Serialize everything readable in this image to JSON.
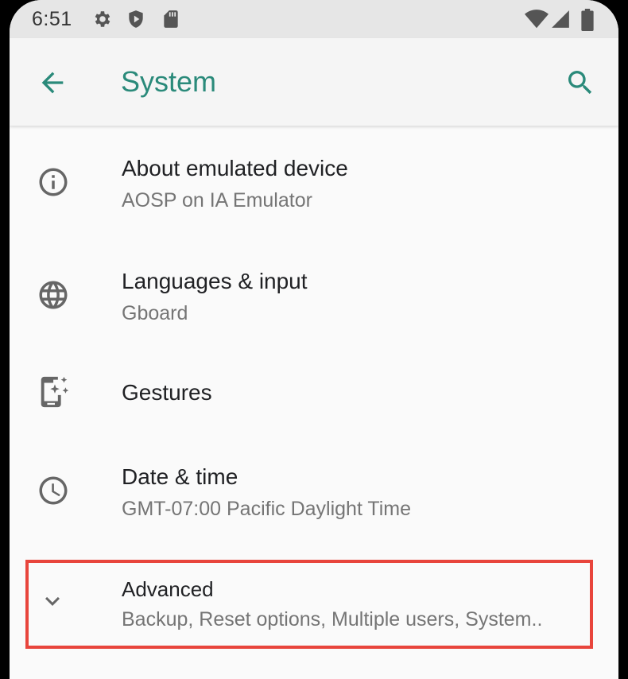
{
  "status_bar": {
    "time": "6:51",
    "left_icons": [
      "gear-icon",
      "shield-icon",
      "sd-card-icon"
    ],
    "right_icons": [
      "wifi-icon",
      "cellular-signal-icon",
      "battery-icon"
    ]
  },
  "app_bar": {
    "title": "System",
    "back_icon": "arrow-back-icon",
    "search_icon": "search-icon",
    "accent_color": "#2a8a7a"
  },
  "items": [
    {
      "icon": "info-icon",
      "title": "About emulated device",
      "subtitle": "AOSP on IA Emulator"
    },
    {
      "icon": "globe-icon",
      "title": "Languages & input",
      "subtitle": "Gboard"
    },
    {
      "icon": "gestures-phone-icon",
      "title": "Gestures",
      "subtitle": ""
    },
    {
      "icon": "clock-icon",
      "title": "Date & time",
      "subtitle": "GMT-07:00 Pacific Daylight Time"
    },
    {
      "icon": "chevron-down-icon",
      "title": "Advanced",
      "subtitle": "Backup, Reset options, Multiple users, System.."
    }
  ],
  "highlight_color": "#e8453c"
}
